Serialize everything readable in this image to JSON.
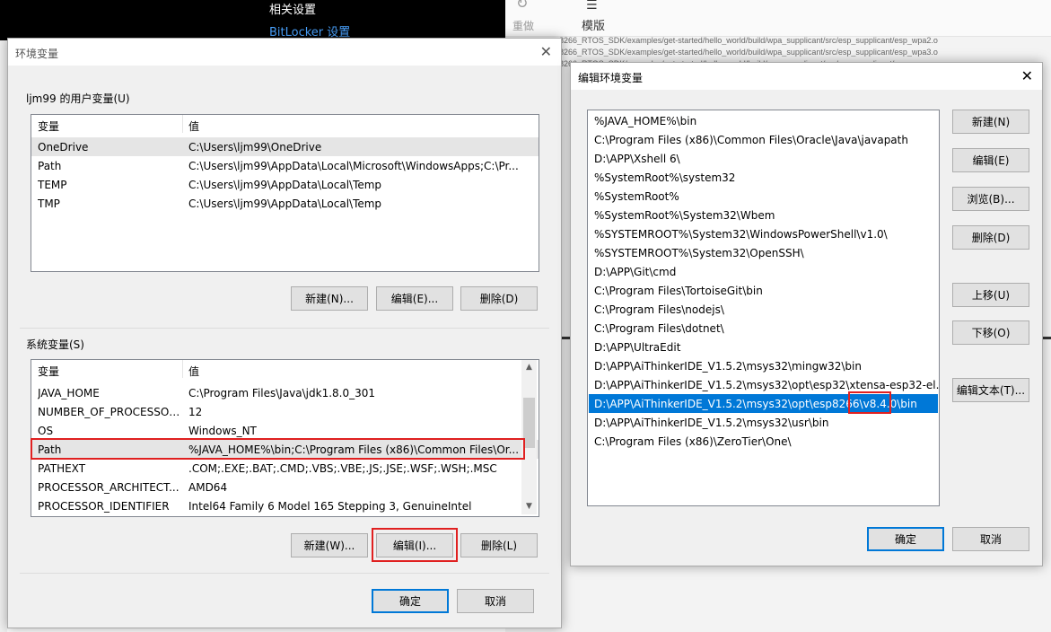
{
  "background": {
    "settings": {
      "line1": "相关设置",
      "line2": "BitLocker 设置"
    },
    "toolbar": {
      "redo_label": "重做",
      "template_label": "模版"
    },
    "log_lines": [
      "8266_RTOS_SDK/examples/get-started/hello_world/build/wpa_supplicant/src/esp_supplicant/esp_wpa2.o",
      "8266_RTOS_SDK/examples/get-started/hello_world/build/wpa_supplicant/src/esp_supplicant/esp_wpa3.o",
      "8266_RTOS_SDK/examples/get-started/hello_world/build/wpa_supplicant/src/esp_supplicant/esp_wps.o"
    ]
  },
  "env_dialog": {
    "title": "环境变量",
    "user_group_label": "ljm99 的用户变量(U)",
    "column_var": "变量",
    "column_val": "值",
    "user_vars": [
      {
        "name": "OneDrive",
        "value": "C:\\Users\\ljm99\\OneDrive"
      },
      {
        "name": "Path",
        "value": "C:\\Users\\ljm99\\AppData\\Local\\Microsoft\\WindowsApps;C:\\Pr..."
      },
      {
        "name": "TEMP",
        "value": "C:\\Users\\ljm99\\AppData\\Local\\Temp"
      },
      {
        "name": "TMP",
        "value": "C:\\Users\\ljm99\\AppData\\Local\\Temp"
      }
    ],
    "user_buttons": {
      "new": "新建(N)...",
      "edit": "编辑(E)...",
      "delete": "删除(D)"
    },
    "system_group_label": "系统变量(S)",
    "system_vars": [
      {
        "name": "JAVA_HOME",
        "value": "C:\\Program Files\\Java\\jdk1.8.0_301"
      },
      {
        "name": "NUMBER_OF_PROCESSORS",
        "value": "12"
      },
      {
        "name": "OS",
        "value": "Windows_NT"
      },
      {
        "name": "Path",
        "value": "%JAVA_HOME%\\bin;C:\\Program Files (x86)\\Common Files\\Or..."
      },
      {
        "name": "PATHEXT",
        "value": ".COM;.EXE;.BAT;.CMD;.VBS;.VBE;.JS;.JSE;.WSF;.WSH;.MSC"
      },
      {
        "name": "PROCESSOR_ARCHITECT...",
        "value": "AMD64"
      },
      {
        "name": "PROCESSOR_IDENTIFIER",
        "value": "Intel64 Family 6 Model 165 Stepping 3, GenuineIntel"
      }
    ],
    "system_buttons": {
      "new": "新建(W)...",
      "edit": "编辑(I)...",
      "delete": "删除(L)"
    },
    "ok": "确定",
    "cancel": "取消"
  },
  "edit_dialog": {
    "title": "编辑环境变量",
    "paths": [
      "%JAVA_HOME%\\bin",
      "C:\\Program Files (x86)\\Common Files\\Oracle\\Java\\javapath",
      "D:\\APP\\Xshell 6\\",
      "%SystemRoot%\\system32",
      "%SystemRoot%",
      "%SystemRoot%\\System32\\Wbem",
      "%SYSTEMROOT%\\System32\\WindowsPowerShell\\v1.0\\",
      "%SYSTEMROOT%\\System32\\OpenSSH\\",
      "D:\\APP\\Git\\cmd",
      "C:\\Program Files\\TortoiseGit\\bin",
      "C:\\Program Files\\nodejs\\",
      "C:\\Program Files\\dotnet\\",
      "D:\\APP\\UltraEdit",
      "D:\\APP\\AiThinkerIDE_V1.5.2\\msys32\\mingw32\\bin",
      "D:\\APP\\AiThinkerIDE_V1.5.2\\msys32\\opt\\esp32\\xtensa-esp32-el...",
      "D:\\APP\\AiThinkerIDE_V1.5.2\\msys32\\opt\\esp8266\\v8.4.0\\bin",
      "D:\\APP\\AiThinkerIDE_V1.5.2\\msys32\\usr\\bin",
      "C:\\Program Files (x86)\\ZeroTier\\One\\"
    ],
    "buttons": {
      "new": "新建(N)",
      "edit": "编辑(E)",
      "browse": "浏览(B)...",
      "delete": "删除(D)",
      "move_up": "上移(U)",
      "move_down": "下移(O)",
      "edit_text": "编辑文本(T)..."
    },
    "ok": "确定",
    "cancel": "取消"
  }
}
